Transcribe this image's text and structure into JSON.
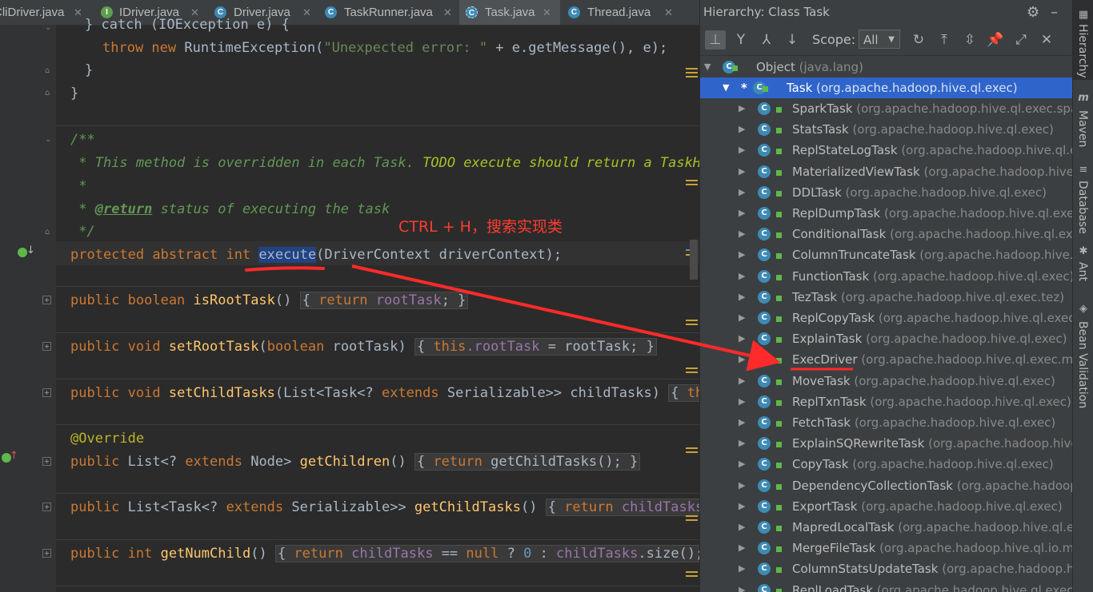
{
  "tabs": [
    {
      "label": "CliDriver.java",
      "icon": "class-icon"
    },
    {
      "label": "IDriver.java",
      "icon": "interface-icon"
    },
    {
      "label": "Driver.java",
      "icon": "class-icon"
    },
    {
      "label": "TaskRunner.java",
      "icon": "class-icon"
    },
    {
      "label": "Task.java",
      "icon": "abstract-class-icon",
      "active": true
    },
    {
      "label": "Thread.java",
      "icon": "class-icon"
    }
  ],
  "code": {
    "l1": "} catch (IOException e) {",
    "l2_kw": "throw new",
    "l2_cls": " RuntimeException(",
    "l2_str": "\"Unexpected error: \"",
    "l2_rest": " + e.getMessage(), e);",
    "l3": "}",
    "l4": "}",
    "doc1": "/**",
    "doc2_a": " * This method is overridden in each Task. ",
    "doc2_todo": "TODO execute should return a TaskHan",
    "doc3": " *",
    "doc4_a": " * ",
    "doc4_tag": "@return",
    "doc4_b": " status of executing the task",
    "doc5": " */",
    "exec_kw": "protected abstract int",
    "exec_name": "execute",
    "exec_rest": "(DriverContext driverContext);",
    "isroot_kw": "public boolean",
    "isroot_name": "isRootTask",
    "isroot_rest": "()",
    "isroot_body_kw": "return",
    "isroot_body_fld": "rootTask",
    "setroot_kw": "public void",
    "setroot_name": "setRootTask",
    "setroot_p1": "(",
    "setroot_pkw": "boolean",
    "setroot_p2": " rootTask)",
    "setroot_body_this": "this",
    "setroot_body_fld": ".rootTask",
    "setroot_body_rest": " = rootTask;",
    "setchild_kw": "public void",
    "setchild_name": "setChildTasks",
    "setchild_p1": "(List<Task<? ",
    "setchild_ext": "extends",
    "setchild_p2": " Serializable>> childTasks)",
    "setchild_body": "this",
    "override": "@Override",
    "getchildren_kw": "public",
    "getchildren_p1": " List<? ",
    "getchildren_ext": "extends",
    "getchildren_p2": " Node> ",
    "getchildren_name": "getChildren",
    "getchildren_p3": "()",
    "getchildren_body_kw": "return",
    "getchildren_body": " getChildTasks();",
    "getchildtasks_kw": "public",
    "getchildtasks_p1": " List<Task<? ",
    "getchildtasks_ext": "extends",
    "getchildtasks_p2": " Serializable>> ",
    "getchildtasks_name": "getChildTasks",
    "getchildtasks_p3": "()",
    "getchildtasks_body_kw": "return",
    "getchildtasks_body_fld": "childTasks;",
    "getnum_kw": "public int",
    "getnum_name": "getNumChild",
    "getnum_p": "()",
    "getnum_body_kw": "return",
    "getnum_body_fld": "childTasks",
    "getnum_body_a": " == ",
    "getnum_body_null": "null",
    "getnum_body_b": " ? ",
    "getnum_body_zero": "0",
    "getnum_body_c": " : ",
    "getnum_body_fld2": "childTasks",
    "getnum_body_d": ".size();"
  },
  "annotation_text": "CTRL + H，搜索实现类",
  "hierarchy": {
    "title": "Hierarchy:  Class Task",
    "scope_label": "Scope:",
    "scope_value": "All",
    "root": {
      "name": "Object",
      "pkg": "(java.lang)"
    },
    "selected": {
      "name": "Task",
      "pkg": "(org.apache.hadoop.hive.ql.exec)"
    },
    "children": [
      {
        "name": "SparkTask",
        "pkg": "(org.apache.hadoop.hive.ql.exec.spark)"
      },
      {
        "name": "StatsTask",
        "pkg": "(org.apache.hadoop.hive.ql.exec)"
      },
      {
        "name": "ReplStateLogTask",
        "pkg": "(org.apache.hadoop.hive.ql.exec)"
      },
      {
        "name": "MaterializedViewTask",
        "pkg": "(org.apache.hadoop.hive.ql.exec)"
      },
      {
        "name": "DDLTask",
        "pkg": "(org.apache.hadoop.hive.ql.exec)"
      },
      {
        "name": "ReplDumpTask",
        "pkg": "(org.apache.hadoop.hive.ql.exec)"
      },
      {
        "name": "ConditionalTask",
        "pkg": "(org.apache.hadoop.hive.ql.exec)"
      },
      {
        "name": "ColumnTruncateTask",
        "pkg": "(org.apache.hadoop.hive.ql.io)"
      },
      {
        "name": "FunctionTask",
        "pkg": "(org.apache.hadoop.hive.ql.exec)"
      },
      {
        "name": "TezTask",
        "pkg": "(org.apache.hadoop.hive.ql.exec.tez)"
      },
      {
        "name": "ReplCopyTask",
        "pkg": "(org.apache.hadoop.hive.ql.exec)"
      },
      {
        "name": "ExplainTask",
        "pkg": "(org.apache.hadoop.hive.ql.exec)"
      },
      {
        "name": "ExecDriver",
        "pkg": "(org.apache.hadoop.hive.ql.exec.mr)"
      },
      {
        "name": "MoveTask",
        "pkg": "(org.apache.hadoop.hive.ql.exec)"
      },
      {
        "name": "ReplTxnTask",
        "pkg": "(org.apache.hadoop.hive.ql.exec)"
      },
      {
        "name": "FetchTask",
        "pkg": "(org.apache.hadoop.hive.ql.exec)"
      },
      {
        "name": "ExplainSQRewriteTask",
        "pkg": "(org.apache.hadoop.hive.ql.exec)"
      },
      {
        "name": "CopyTask",
        "pkg": "(org.apache.hadoop.hive.ql.exec)"
      },
      {
        "name": "DependencyCollectionTask",
        "pkg": "(org.apache.hadoop.hive.ql.exec)"
      },
      {
        "name": "ExportTask",
        "pkg": "(org.apache.hadoop.hive.ql.exec)"
      },
      {
        "name": "MapredLocalTask",
        "pkg": "(org.apache.hadoop.hive.ql.exec.mr)"
      },
      {
        "name": "MergeFileTask",
        "pkg": "(org.apache.hadoop.hive.ql.io.merge)"
      },
      {
        "name": "ColumnStatsUpdateTask",
        "pkg": "(org.apache.hadoop.hive.ql.exec)"
      },
      {
        "name": "ReplLoadTask",
        "pkg": "(org.apache.hadoop.hive.ql.exec)"
      }
    ]
  },
  "stripe": {
    "hierarchy": "Hierarchy",
    "maven": "Maven",
    "database": "Database",
    "ant": "Ant",
    "bean": "Bean Validation"
  },
  "colors": {
    "annotation": "#ff3b30",
    "selection": "#2f65ca",
    "keyword": "#cc7832"
  }
}
